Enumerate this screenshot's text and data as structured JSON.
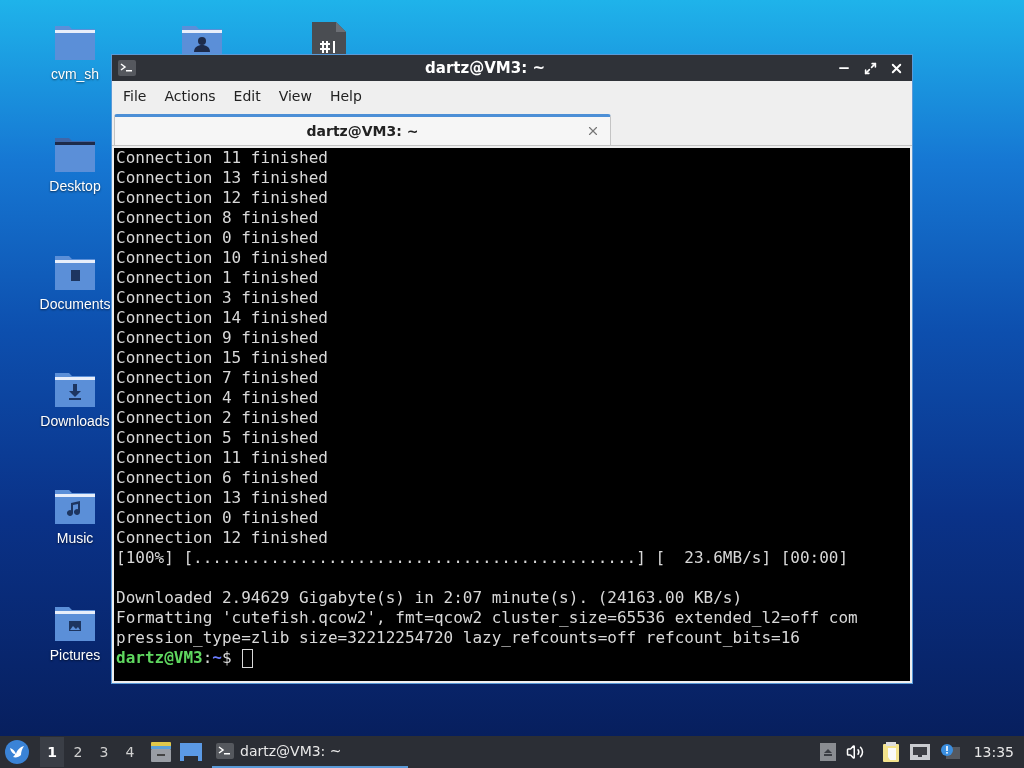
{
  "desktop_icons": [
    {
      "kind": "folder",
      "label": "cvm_sh"
    },
    {
      "kind": "desktop",
      "label": "Desktop"
    },
    {
      "kind": "documents",
      "label": "Documents"
    },
    {
      "kind": "downloads",
      "label": "Downloads"
    },
    {
      "kind": "music",
      "label": "Music"
    },
    {
      "kind": "pictures",
      "label": "Pictures"
    },
    {
      "kind": "home"
    },
    {
      "kind": "script"
    }
  ],
  "window": {
    "title": "dartz@VM3: ~",
    "menu": [
      "File",
      "Actions",
      "Edit",
      "View",
      "Help"
    ],
    "tabs": [
      {
        "label": "dartz@VM3: ~",
        "selected": true
      }
    ],
    "terminal": {
      "blocks": [
        [
          "Connection 11 finished",
          "Connection 13 finished",
          "Connection 12 finished",
          "Connection 8 finished",
          "Connection 0 finished",
          "Connection 10 finished",
          "Connection 1 finished",
          "Connection 3 finished",
          "Connection 14 finished",
          "Connection 9 finished",
          "Connection 15 finished",
          "Connection 7 finished",
          "Connection 4 finished",
          "Connection 2 finished",
          "Connection 5 finished",
          "Connection 11 finished",
          "Connection 6 finished",
          "Connection 13 finished",
          "Connection 0 finished",
          "Connection 12 finished",
          "[100%] [..............................................] [  23.6MB/s] [00:00]"
        ],
        [
          "Downloaded 2.94629 Gigabyte(s) in 2:07 minute(s). (24163.00 KB/s)",
          "Formatting 'cutefish.qcow2', fmt=qcow2 cluster_size=65536 extended_l2=off com",
          "pression_type=zlib size=32212254720 lazy_refcounts=off refcount_bits=16"
        ]
      ],
      "prompt": {
        "user_host": "dartz@VM3",
        "separator": ":",
        "path": "~",
        "symbol": "$"
      }
    }
  },
  "taskbar": {
    "workspaces": [
      {
        "label": "1",
        "selected": true
      },
      {
        "label": "2",
        "selected": false
      },
      {
        "label": "3",
        "selected": false
      },
      {
        "label": "4",
        "selected": false
      }
    ],
    "tasks": [
      {
        "label": "dartz@VM3: ~",
        "selected": true
      }
    ],
    "clock": "13:35"
  }
}
